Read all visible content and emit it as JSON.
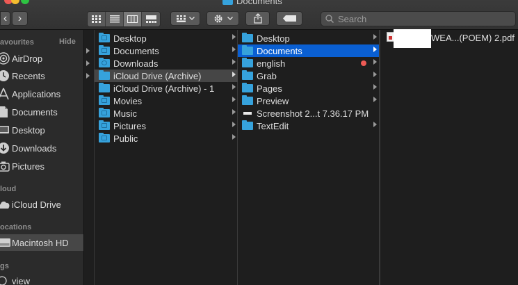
{
  "window": {
    "title": "Documents"
  },
  "toolbar": {
    "back_label": "‹",
    "forward_label": "›",
    "view_modes": [
      "icon-view",
      "list-view",
      "column-view",
      "gallery-view"
    ],
    "active_view": "column-view",
    "search_placeholder": "Search",
    "colors": {
      "close": "#ee5a55",
      "minimize": "#f3bc2f",
      "zoom": "#2ec342"
    }
  },
  "sidebar": {
    "favourites_heading": "avourites",
    "hide_label": "Hide",
    "favourites": [
      {
        "label": "AirDrop",
        "icon": "airdrop-icon"
      },
      {
        "label": "Recents",
        "icon": "clock-icon"
      },
      {
        "label": "Applications",
        "icon": "applications-icon"
      },
      {
        "label": "Documents",
        "icon": "document-icon"
      },
      {
        "label": "Desktop",
        "icon": "desktop-icon"
      },
      {
        "label": "Downloads",
        "icon": "download-icon"
      },
      {
        "label": "Pictures",
        "icon": "camera-icon"
      }
    ],
    "icloud_heading": "loud",
    "icloud": [
      {
        "label": "iCloud Drive",
        "icon": "cloud-icon"
      }
    ],
    "locations_heading": "ocations",
    "locations": [
      {
        "label": "Macintosh HD",
        "icon": "hard-drive-icon",
        "selected": true
      }
    ],
    "tags_heading": "gs",
    "tags": [
      {
        "label": "view",
        "icon": "tag-circle-icon"
      }
    ]
  },
  "column1": [
    {
      "label": "Desktop"
    },
    {
      "label": "Documents"
    },
    {
      "label": "Downloads"
    },
    {
      "label": "iCloud Drive (Archive)",
      "selected": true
    },
    {
      "label": "iCloud Drive (Archive) - 1"
    },
    {
      "label": "Movies"
    },
    {
      "label": "Music"
    },
    {
      "label": "Pictures"
    },
    {
      "label": "Public"
    }
  ],
  "column2": [
    {
      "label": "Desktop"
    },
    {
      "label": "Documents",
      "selected": true
    },
    {
      "label": "english",
      "tag_color": "#ee5a55"
    },
    {
      "label": "Grab"
    },
    {
      "label": "Pages"
    },
    {
      "label": "Preview"
    },
    {
      "label": "Screenshot 2...t 7.36.17 PM",
      "kind": "screenshot"
    },
    {
      "label": "TextEdit"
    }
  ],
  "column3": [
    {
      "label": "WEA...(POEM) 2.pdf",
      "kind": "pdf"
    }
  ]
}
